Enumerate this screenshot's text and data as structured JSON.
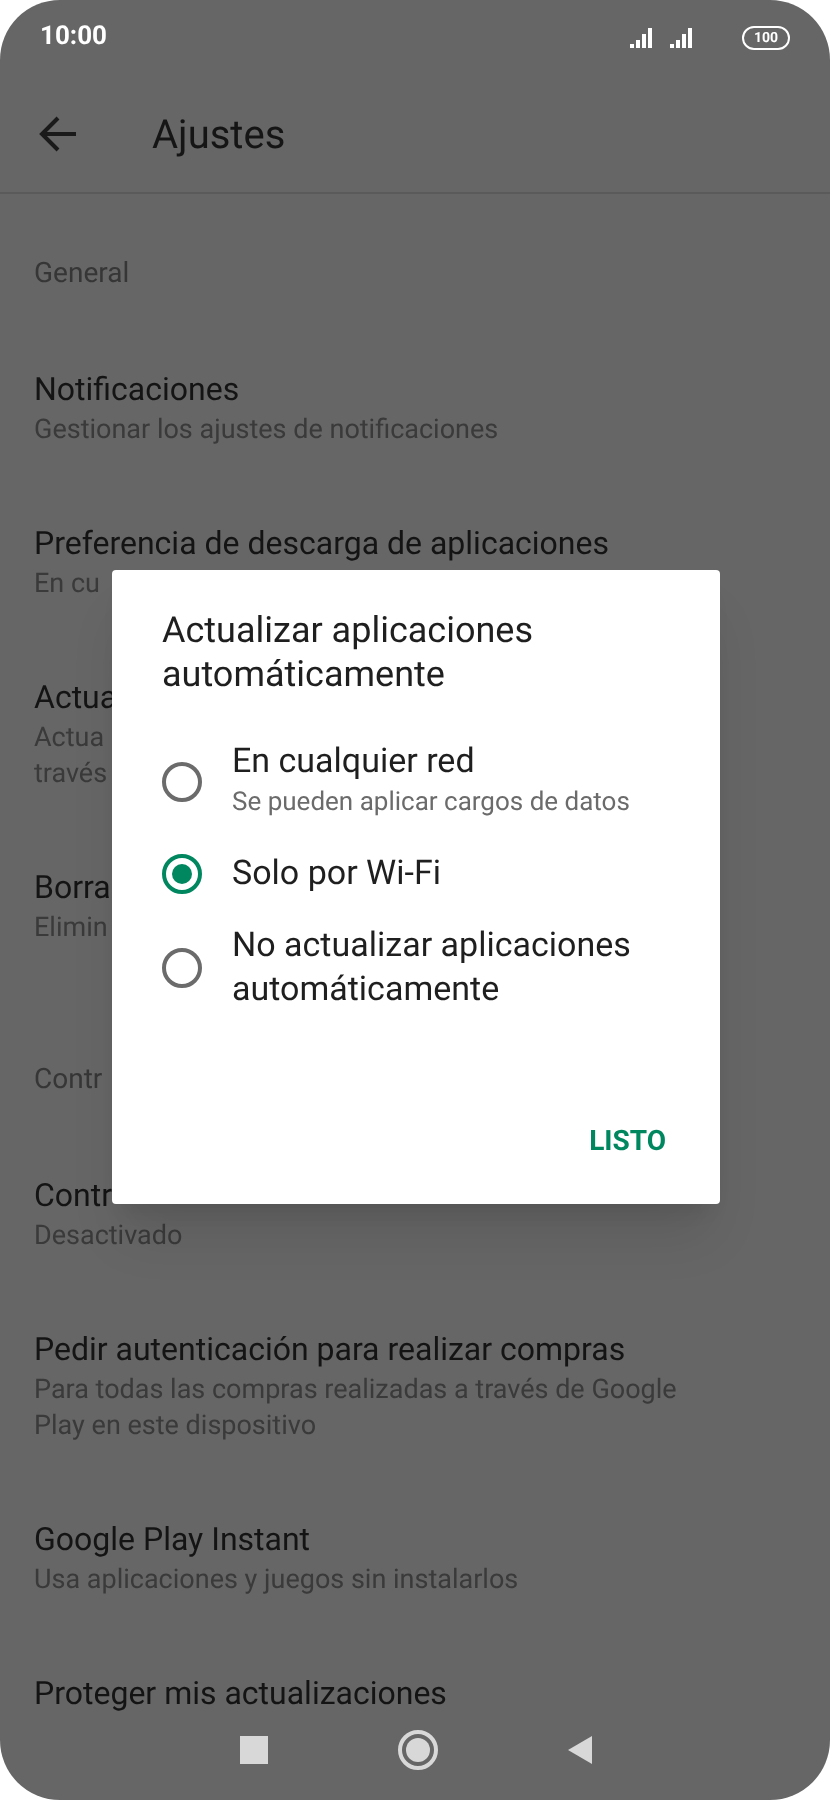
{
  "status_bar": {
    "time": "10:00",
    "battery": "100"
  },
  "app_bar": {
    "title": "Ajustes"
  },
  "sections": [
    {
      "header": "General",
      "items": [
        {
          "title": "Notificaciones",
          "subtitle_lines": [
            "Gestionar los ajustes de notificaciones"
          ]
        },
        {
          "title": "Preferencia de descarga de aplicaciones",
          "subtitle_lines": [
            "En cu"
          ]
        },
        {
          "title": "Actua",
          "subtitle_lines": [
            "Actua",
            "través"
          ]
        },
        {
          "title": "Borra",
          "subtitle_lines": [
            "Elimin"
          ]
        }
      ]
    },
    {
      "header": "Contr",
      "items": [
        {
          "title": "Contr",
          "subtitle_lines": [
            "Desactivado"
          ]
        },
        {
          "title": "Pedir autenticación para realizar compras",
          "subtitle_lines": [
            "Para todas las compras realizadas a través de Google",
            "Play en este dispositivo"
          ]
        },
        {
          "title": "Google Play Instant",
          "subtitle_lines": [
            "Usa aplicaciones y juegos sin instalarlos"
          ]
        },
        {
          "title": "Proteger mis actualizaciones"
        }
      ]
    }
  ],
  "dialog": {
    "title": "Actualizar aplicaciones automáticamente",
    "options": [
      {
        "label": "En cualquier red",
        "subtitle": "Se pueden aplicar cargos de datos",
        "selected": false
      },
      {
        "label": "Solo por Wi-Fi",
        "selected": true
      },
      {
        "label": "No actualizar aplicaciones automáticamente",
        "selected": false
      }
    ],
    "button": "LISTO"
  }
}
